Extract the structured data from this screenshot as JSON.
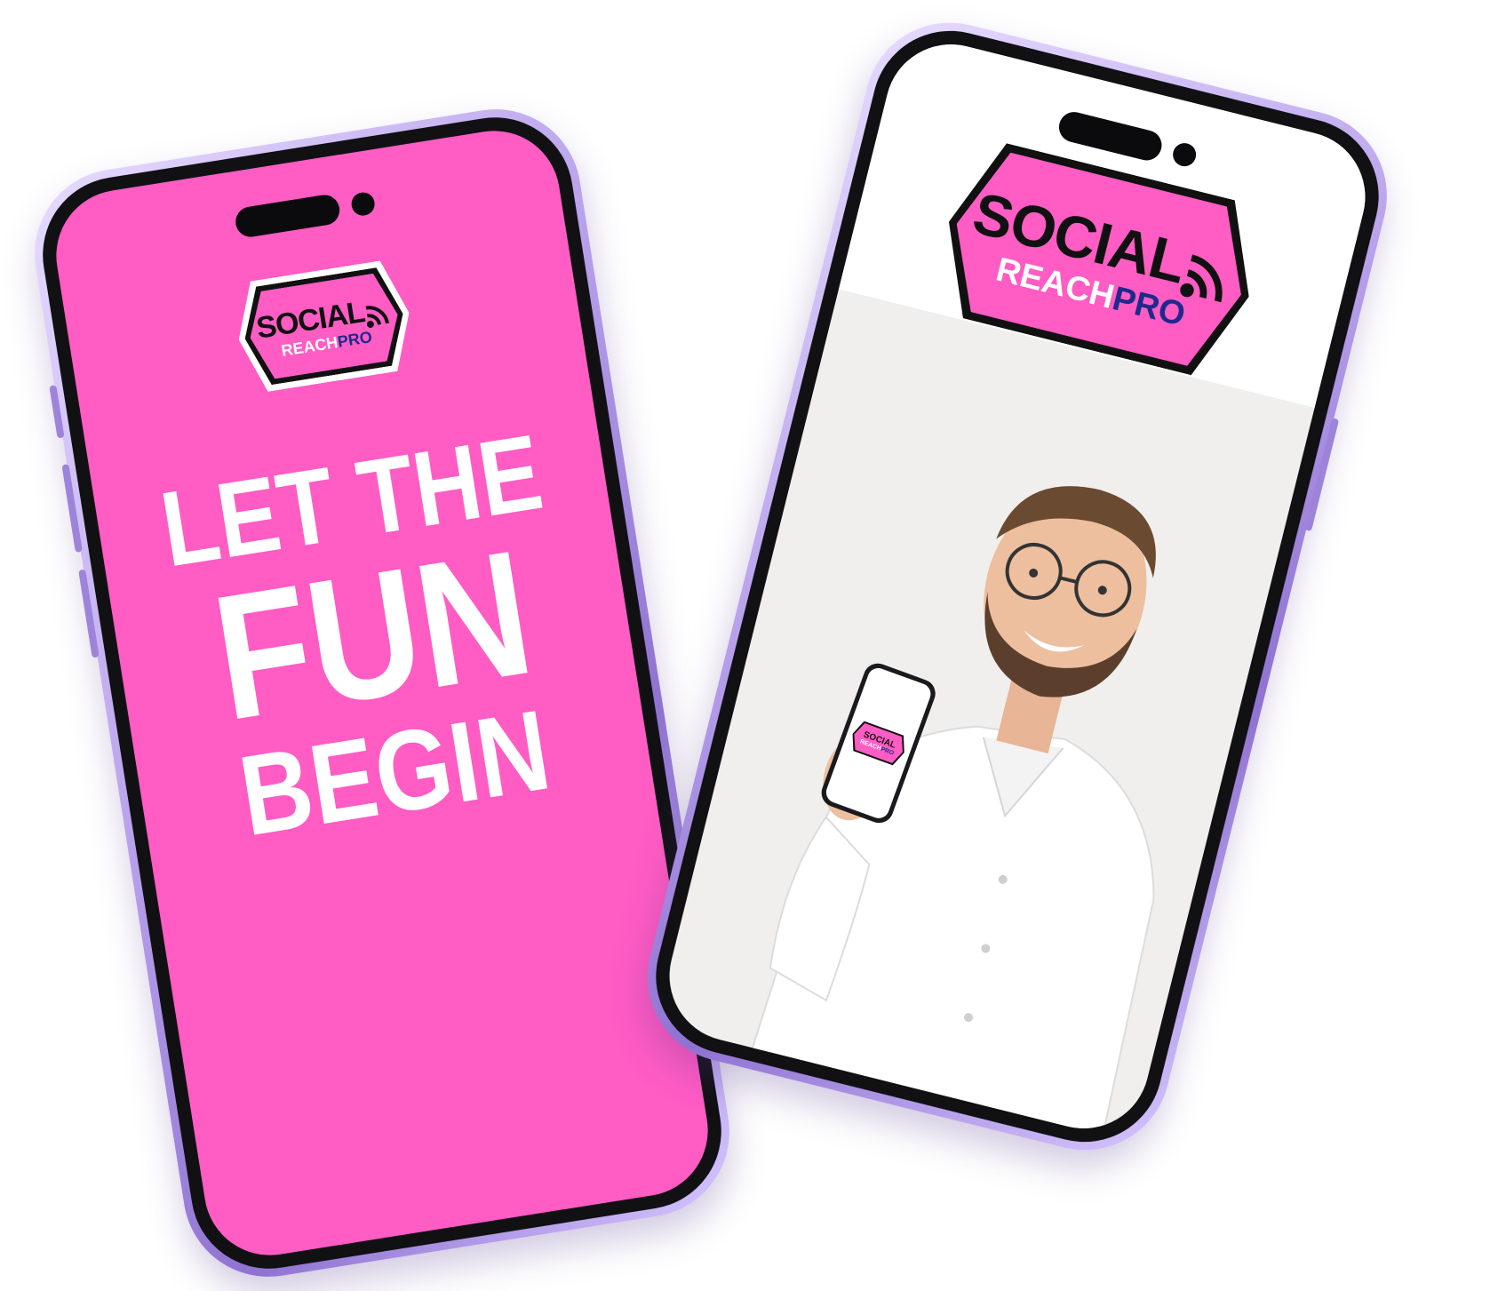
{
  "brand": {
    "name_line1": "SOCIAL",
    "name_reach": "REACH",
    "name_pro": "PRO",
    "pink": "#ff5cc4",
    "navy": "#1e2a8c",
    "frame_purple": "#b9a2ec"
  },
  "left_phone": {
    "headline": [
      "LET THE",
      "FUN",
      "BEGIN"
    ]
  },
  "right_phone": {
    "photo_subject": "smiling man in white shirt and glasses holding a phone",
    "mini_logo_line1": "SOCIAL",
    "mini_logo_reach": "REACH",
    "mini_logo_pro": "PRO"
  },
  "icons": {
    "wifi": "wifi-signal-icon"
  }
}
